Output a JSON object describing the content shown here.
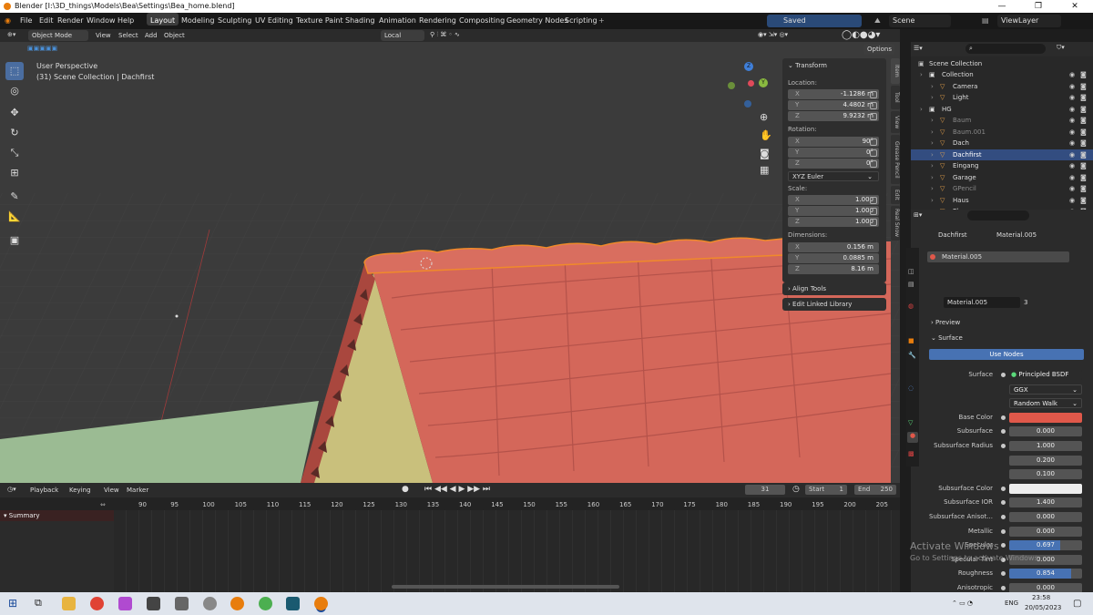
{
  "window": {
    "title": "Blender [I:\\3D_things\\Models\\Bea\\Settings\\Bea_home.blend]",
    "min": "—",
    "max": "❐",
    "close": "✕"
  },
  "menu": {
    "file": "File",
    "edit": "Edit",
    "render": "Render",
    "window": "Window",
    "help": "Help"
  },
  "workspaces": [
    "Layout",
    "Modeling",
    "Sculpting",
    "UV Editing",
    "Texture Paint",
    "Shading",
    "Animation",
    "Rendering",
    "Compositing",
    "Geometry Nodes",
    "Scripting"
  ],
  "add_workspace": "+",
  "status_saved": "Saved \"Bea_home.blend\"",
  "scene": "Scene",
  "view_layer": "ViewLayer",
  "header3d": {
    "mode": "Object Mode",
    "view": "View",
    "select": "Select",
    "add": "Add",
    "object": "Object",
    "orientation": "Local",
    "options": "Options"
  },
  "viewport": {
    "perspective": "User Perspective",
    "collection": "(31) Scene Collection | Dachfirst"
  },
  "gizmo": {
    "z": "Z",
    "y": "Y",
    "x": "X"
  },
  "npanel": {
    "transform": "Transform",
    "location": "Location:",
    "rotation": "Rotation:",
    "scale": "Scale:",
    "dimensions": "Dimensions:",
    "loc": [
      {
        "ax": "X",
        "v": "-1.1286 m"
      },
      {
        "ax": "Y",
        "v": "4.4802 m"
      },
      {
        "ax": "Z",
        "v": "9.9232 m"
      }
    ],
    "rot": [
      {
        "ax": "X",
        "v": "90°"
      },
      {
        "ax": "Y",
        "v": "0°"
      },
      {
        "ax": "Z",
        "v": "0°"
      }
    ],
    "euler": "XYZ Euler",
    "scl": [
      {
        "ax": "X",
        "v": "1.000"
      },
      {
        "ax": "Y",
        "v": "1.000"
      },
      {
        "ax": "Z",
        "v": "1.000"
      }
    ],
    "dim": [
      {
        "ax": "X",
        "v": "0.156 m"
      },
      {
        "ax": "Y",
        "v": "0.0885 m"
      },
      {
        "ax": "Z",
        "v": "8.16 m"
      }
    ],
    "align": "Align Tools",
    "linked": "Edit Linked Library"
  },
  "sidetabs": [
    "Item",
    "Tool",
    "View",
    "Grease Pencil",
    "Edit",
    "Real Snow"
  ],
  "outliner": {
    "root": "Scene Collection",
    "rows": [
      {
        "label": "Collection",
        "indent": 1,
        "color": "#ddd"
      },
      {
        "label": "Camera",
        "indent": 2,
        "color": "#ddd"
      },
      {
        "label": "Light",
        "indent": 2,
        "color": "#ddd"
      },
      {
        "label": "HG",
        "indent": 1,
        "color": "#ddd"
      },
      {
        "label": "Baum",
        "indent": 2,
        "color": "#888"
      },
      {
        "label": "Baum.001",
        "indent": 2,
        "color": "#888"
      },
      {
        "label": "Dach",
        "indent": 2,
        "color": "#ddd"
      },
      {
        "label": "Dachfirst",
        "indent": 2,
        "color": "#fff"
      },
      {
        "label": "Eingang",
        "indent": 2,
        "color": "#ddd"
      },
      {
        "label": "Garage",
        "indent": 2,
        "color": "#ddd"
      },
      {
        "label": "GPencil",
        "indent": 2,
        "color": "#888"
      },
      {
        "label": "Haus",
        "indent": 2,
        "color": "#ddd"
      },
      {
        "label": "Plane",
        "indent": 2,
        "color": "#ddd"
      }
    ]
  },
  "props": {
    "object": "Dachfirst",
    "material": "Material.005",
    "slot": "Material.005",
    "users": "3",
    "preview": "Preview",
    "surface": "Surface",
    "use_nodes": "Use Nodes",
    "rows": [
      {
        "label": "Surface",
        "value": "Principled BSDF",
        "type": "text"
      },
      {
        "label": "",
        "value": "GGX",
        "type": "select"
      },
      {
        "label": "",
        "value": "Random Walk",
        "type": "select"
      },
      {
        "label": "Base Color",
        "value": "",
        "type": "color",
        "color": "#e0584a"
      },
      {
        "label": "Subsurface",
        "value": "0.000",
        "type": "num"
      },
      {
        "label": "Subsurface Radius",
        "value": "1.000",
        "type": "num"
      },
      {
        "label": "",
        "value": "0.200",
        "type": "num"
      },
      {
        "label": "",
        "value": "0.100",
        "type": "num"
      },
      {
        "label": "Subsurface Color",
        "value": "",
        "type": "color",
        "color": "#eeeeee"
      },
      {
        "label": "Subsurface IOR",
        "value": "1.400",
        "type": "num"
      },
      {
        "label": "Subsurface Anisot...",
        "value": "0.000",
        "type": "num"
      },
      {
        "label": "Metallic",
        "value": "0.000",
        "type": "num"
      },
      {
        "label": "Specular",
        "value": "0.697",
        "type": "bar"
      },
      {
        "label": "Specular Tint",
        "value": "0.000",
        "type": "num"
      },
      {
        "label": "Roughness",
        "value": "0.854",
        "type": "bar"
      },
      {
        "label": "Anisotropic",
        "value": "0.000",
        "type": "num"
      }
    ]
  },
  "watermark": {
    "line1": "Activate Windows",
    "line2": "Go to Settings to activate Windows."
  },
  "timeline": {
    "playback": "Playback",
    "keying": "Keying",
    "view": "View",
    "marker": "Marker",
    "frame": "31",
    "start_label": "Start",
    "start": "1",
    "end_label": "End",
    "end": "250",
    "summary": "Summary",
    "ticks": [
      "90",
      "95",
      "100",
      "105",
      "110",
      "115",
      "120",
      "125",
      "130",
      "135",
      "140",
      "145",
      "150",
      "155",
      "160",
      "165",
      "170",
      "175",
      "180",
      "185",
      "190",
      "195",
      "200",
      "205"
    ]
  },
  "taskbar": {
    "lang": "ENG",
    "time": "23:58",
    "date": "20/05/2023"
  }
}
